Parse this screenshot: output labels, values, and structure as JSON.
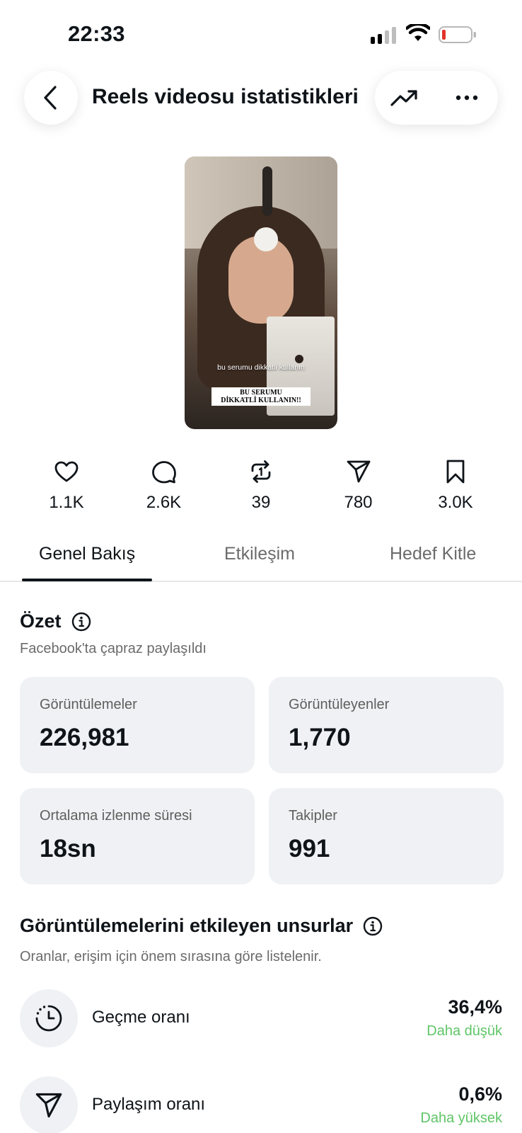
{
  "status_bar": {
    "time": "22:33"
  },
  "header": {
    "title": "Reels videosu istatistikleri"
  },
  "thumbnail": {
    "caption_top": "bu serumu dikkatli kullanın",
    "caption_box_line1": "BU SERUMU",
    "caption_box_line2": "DİKKATLİ KULLANIN!!"
  },
  "stats": [
    {
      "icon": "heart-icon",
      "value": "1.1K"
    },
    {
      "icon": "comment-icon",
      "value": "2.6K"
    },
    {
      "icon": "repost-icon",
      "value": "39"
    },
    {
      "icon": "send-icon",
      "value": "780"
    },
    {
      "icon": "bookmark-icon",
      "value": "3.0K"
    }
  ],
  "tabs": [
    {
      "label": "Genel Bakış",
      "active": true
    },
    {
      "label": "Etkileşim",
      "active": false
    },
    {
      "label": "Hedef Kitle",
      "active": false
    }
  ],
  "summary": {
    "title": "Özet",
    "subtitle": "Facebook'ta çapraz paylaşıldı",
    "cards": [
      {
        "label": "Görüntülemeler",
        "value": "226,981"
      },
      {
        "label": "Görüntüleyenler",
        "value": "1,770"
      },
      {
        "label": "Ortalama izlenme süresi",
        "value": "18sn"
      },
      {
        "label": "Takipler",
        "value": "991"
      }
    ]
  },
  "factors": {
    "title": "Görüntülemelerini etkileyen unsurlar",
    "subtitle": "Oranlar, erişim için önem sırasına göre listelenir.",
    "items": [
      {
        "icon": "timer-icon",
        "label": "Geçme oranı",
        "value": "36,4%",
        "note": "Daha düşük"
      },
      {
        "icon": "send-icon",
        "label": "Paylaşım oranı",
        "value": "0,6%",
        "note": "Daha yüksek"
      }
    ]
  },
  "colors": {
    "positive_note": "#5fc567",
    "card_bg": "#eff1f4",
    "battery_low": "#e0352b"
  }
}
